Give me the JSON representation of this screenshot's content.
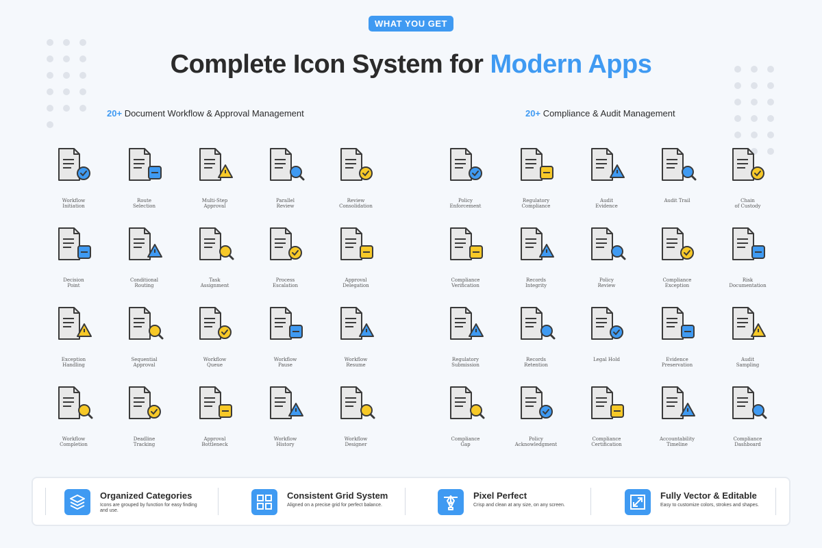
{
  "badge": "WHAT YOU GET",
  "title": {
    "main": "Complete Icon System for ",
    "accent": "Modern Apps"
  },
  "colors": {
    "accent": "#3f9af2",
    "yellow": "#f7c928",
    "blue": "#3f9af2",
    "paper": "#e8e8e8",
    "outline": "#3a3a3a"
  },
  "left": {
    "count": "20+",
    "title": "Document Workflow & Approval Management",
    "icons": [
      {
        "name": "workflow-initiation-icon",
        "label": "Workflow\nInitiation",
        "fill": "blue"
      },
      {
        "name": "route-selection-icon",
        "label": "Route\nSelection",
        "fill": "blue"
      },
      {
        "name": "multi-step-approval-icon",
        "label": "Multi-Step\nApproval",
        "fill": "yellow"
      },
      {
        "name": "parallel-review-icon",
        "label": "Parallel\nReview",
        "fill": "blue"
      },
      {
        "name": "review-consolidation-icon",
        "label": "Review\nConsolidation",
        "fill": "yellow"
      },
      {
        "name": "decision-point-icon",
        "label": "Decision\nPoint",
        "fill": "blue"
      },
      {
        "name": "conditional-routing-icon",
        "label": "Conditional\nRouting",
        "fill": "blue"
      },
      {
        "name": "task-assignment-icon",
        "label": "Task\nAssignment",
        "fill": "yellow"
      },
      {
        "name": "process-escalation-icon",
        "label": "Process\nEscalation",
        "fill": "yellow"
      },
      {
        "name": "approval-delegation-icon",
        "label": "Approval\nDelegation",
        "fill": "yellow"
      },
      {
        "name": "exception-handling-icon",
        "label": "Exception\nHandling",
        "fill": "yellow"
      },
      {
        "name": "sequential-approval-icon",
        "label": "Sequential\nApproval",
        "fill": "yellow"
      },
      {
        "name": "workflow-queue-icon",
        "label": "Workflow\nQueue",
        "fill": "yellow"
      },
      {
        "name": "workflow-pause-icon",
        "label": "Workflow\nPause",
        "fill": "blue"
      },
      {
        "name": "workflow-resume-icon",
        "label": "Workflow\nResume",
        "fill": "blue"
      },
      {
        "name": "workflow-completion-icon",
        "label": "Workflow\nCompletion",
        "fill": "yellow"
      },
      {
        "name": "deadline-tracking-icon",
        "label": "Deadline\nTracking",
        "fill": "yellow"
      },
      {
        "name": "approval-bottleneck-icon",
        "label": "Approval\nBottleneck",
        "fill": "yellow"
      },
      {
        "name": "workflow-history-icon",
        "label": "Workflow\nHistory",
        "fill": "blue"
      },
      {
        "name": "workflow-designer-icon",
        "label": "Workflow\nDesigner",
        "fill": "yellow"
      }
    ]
  },
  "right": {
    "count": "20+",
    "title": "Compliance & Audit Management",
    "icons": [
      {
        "name": "policy-enforcement-icon",
        "label": "Policy\nEnforcement",
        "fill": "blue"
      },
      {
        "name": "regulatory-compliance-icon",
        "label": "Regulatory\nCompliance",
        "fill": "yellow"
      },
      {
        "name": "audit-evidence-icon",
        "label": "Audit\nEvidence",
        "fill": "blue"
      },
      {
        "name": "audit-trail-icon",
        "label": "Audit Trail",
        "fill": "blue"
      },
      {
        "name": "chain-of-custody-icon",
        "label": "Chain\nof Custody",
        "fill": "yellow"
      },
      {
        "name": "compliance-verification-icon",
        "label": "Compliance\nVerification",
        "fill": "yellow"
      },
      {
        "name": "records-integrity-icon",
        "label": "Records\nIntegrity",
        "fill": "blue"
      },
      {
        "name": "policy-review-icon",
        "label": "Policy\nReview",
        "fill": "blue"
      },
      {
        "name": "compliance-exception-icon",
        "label": "Compliance\nException",
        "fill": "yellow"
      },
      {
        "name": "risk-documentation-icon",
        "label": "Risk\nDocumentation",
        "fill": "blue"
      },
      {
        "name": "regulatory-submission-icon",
        "label": "Regulatory\nSubmission",
        "fill": "blue"
      },
      {
        "name": "records-retention-icon",
        "label": "Records\nRetention",
        "fill": "blue"
      },
      {
        "name": "legal-hold-icon",
        "label": "Legal Hold",
        "fill": "blue"
      },
      {
        "name": "evidence-preservation-icon",
        "label": "Evidence\nPreservation",
        "fill": "blue"
      },
      {
        "name": "audit-sampling-icon",
        "label": "Audit\nSampling",
        "fill": "yellow"
      },
      {
        "name": "compliance-gap-icon",
        "label": "Compliance\nGap",
        "fill": "yellow"
      },
      {
        "name": "policy-acknowledgment-icon",
        "label": "Policy\nAcknowledgment",
        "fill": "blue"
      },
      {
        "name": "compliance-certification-icon",
        "label": "Compliance\nCertification",
        "fill": "yellow"
      },
      {
        "name": "accountability-timeline-icon",
        "label": "Accountability\nTimeline",
        "fill": "blue"
      },
      {
        "name": "compliance-dashboard-icon",
        "label": "Compliance\nDashboard",
        "fill": "blue"
      }
    ]
  },
  "features": [
    {
      "name": "organized-categories",
      "icon": "layers-icon",
      "title": "Organized Categories",
      "desc": "Icons are grouped by function for easy finding and use."
    },
    {
      "name": "consistent-grid-system",
      "icon": "grid-icon",
      "title": "Consistent Grid System",
      "desc": "Aligned on a precise grid for perfect balance."
    },
    {
      "name": "pixel-perfect",
      "icon": "pen-tool-icon",
      "title": "Pixel Perfect",
      "desc": "Crisp and clean at any size, on any screen."
    },
    {
      "name": "fully-vector-editable",
      "icon": "resize-icon",
      "title": "Fully Vector & Editable",
      "desc": "Easy to customize colors, strokes and shapes."
    }
  ]
}
